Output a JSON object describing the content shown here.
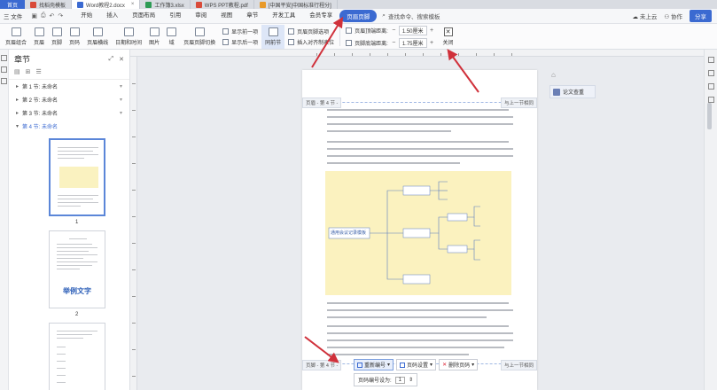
{
  "tabs": {
    "home": "首页",
    "items": [
      {
        "label": "找稻壳模板",
        "color": "#d94b3a",
        "active": false
      },
      {
        "label": "Word教程2.docx",
        "color": "#3b6ad1",
        "active": true
      },
      {
        "label": "工作簿3.xlsx",
        "color": "#2e9b55",
        "active": false
      },
      {
        "label": "WPS PPT教程.pdf",
        "color": "#d94b3a",
        "active": false
      },
      {
        "label": "[中国平安]中国标准行程分]",
        "color": "#e89a2a",
        "active": false
      }
    ]
  },
  "menubar": {
    "file": "三 文件",
    "items": [
      "开始",
      "插入",
      "页面布局",
      "引用",
      "审阅",
      "视图",
      "章节",
      "开发工具",
      "会员专享"
    ],
    "active": "页眉页脚",
    "search": "查找命令、搜索模板",
    "unsynced": "未上云",
    "collab": "协作",
    "share": "分享"
  },
  "ribbon": {
    "btn1": "页眉组合",
    "btn2": "页眉",
    "btn3": "页脚",
    "btn4": "页码",
    "btn5": "页眉横线",
    "btn6": "日期和时间",
    "btn7": "图片",
    "btn8": "域",
    "btn9": "页眉页脚切换",
    "show_prev": "显示前一项",
    "show_next": "显示后一项",
    "same_as_prev": "同前节",
    "page_setup_options": "页眉页脚选项",
    "insert_align_tab": "插入对齐制表位",
    "header_top_label": "页眉顶端距离:",
    "header_top_val": "1.50厘米",
    "footer_bottom_label": "页脚底端距离:",
    "footer_bottom_val": "1.75厘米",
    "close": "关闭"
  },
  "chapter": {
    "title": "章节",
    "sections": [
      {
        "label": "第 1 节: 未命名",
        "active": false
      },
      {
        "label": "第 2 节: 未命名",
        "active": false
      },
      {
        "label": "第 3 节: 未命名",
        "active": false
      },
      {
        "label": "第 4 节: 未命名",
        "active": true
      }
    ],
    "thumbs": [
      {
        "num": "1",
        "selected": true
      },
      {
        "num": "2",
        "selected": false,
        "big_text": "举例文字"
      },
      {
        "num": "",
        "selected": false
      }
    ]
  },
  "page": {
    "header_left_tag": "页眉 - 第 4 节 -",
    "header_right_tag": "与上一节相同",
    "footer_left_tag": "页脚 - 第 4 节 -",
    "footer_right_tag": "与上一节相同",
    "renumber": "重新编号",
    "page_num_settings": "页码设置",
    "delete_page_num": "删除页码",
    "start_at_label": "页码编号设为:",
    "start_at_value": "1"
  },
  "mindmap": {
    "center": "通用会议记录模板"
  },
  "rightpanel": {
    "paper_check": "论文查重"
  }
}
